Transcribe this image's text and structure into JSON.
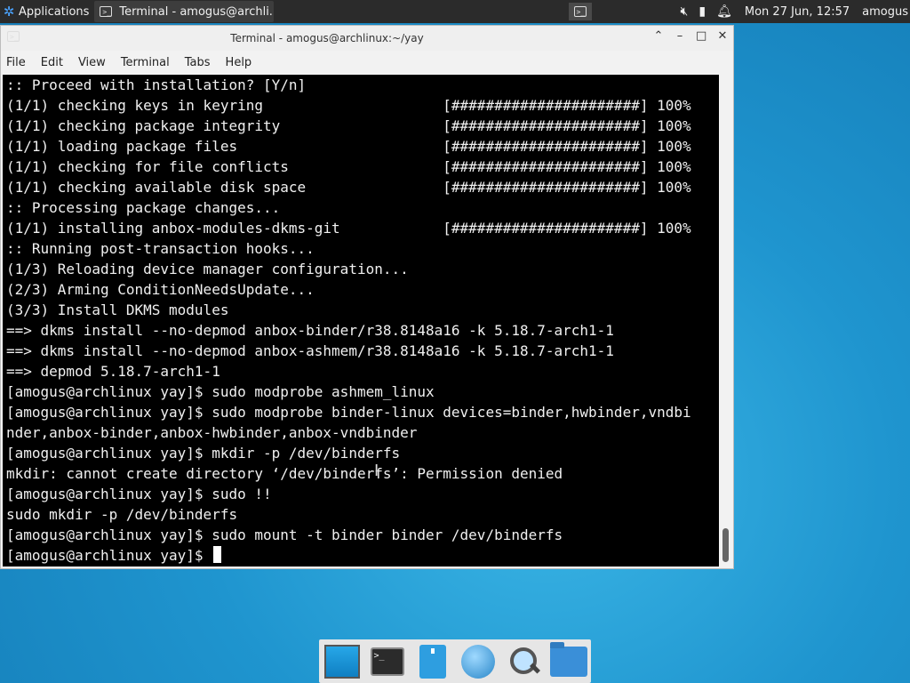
{
  "panel": {
    "applications_label": "Applications",
    "task_label": "Terminal - amogus@archli...",
    "clock": "Mon 27 Jun, 12:57",
    "user": "amogus"
  },
  "window": {
    "title": "Terminal - amogus@archlinux:~/yay",
    "menu": [
      "File",
      "Edit",
      "View",
      "Terminal",
      "Tabs",
      "Help"
    ]
  },
  "terminal": {
    "lines": [
      ":: Proceed with installation? [Y/n]",
      "(1/1) checking keys in keyring                     [######################] 100%",
      "(1/1) checking package integrity                   [######################] 100%",
      "(1/1) loading package files                        [######################] 100%",
      "(1/1) checking for file conflicts                  [######################] 100%",
      "(1/1) checking available disk space                [######################] 100%",
      ":: Processing package changes...",
      "(1/1) installing anbox-modules-dkms-git            [######################] 100%",
      ":: Running post-transaction hooks...",
      "(1/3) Reloading device manager configuration...",
      "(2/3) Arming ConditionNeedsUpdate...",
      "(3/3) Install DKMS modules",
      "==> dkms install --no-depmod anbox-binder/r38.8148a16 -k 5.18.7-arch1-1",
      "==> dkms install --no-depmod anbox-ashmem/r38.8148a16 -k 5.18.7-arch1-1",
      "==> depmod 5.18.7-arch1-1",
      "[amogus@archlinux yay]$ sudo modprobe ashmem_linux",
      "[amogus@archlinux yay]$ sudo modprobe binder-linux devices=binder,hwbinder,vndbi",
      "nder,anbox-binder,anbox-hwbinder,anbox-vndbinder",
      "[amogus@archlinux yay]$ mkdir -p /dev/binderfs",
      "mkdir: cannot create directory ‘/dev/binderfs’: Permission denied",
      "[amogus@archlinux yay]$ sudo !!",
      "sudo mkdir -p /dev/binderfs",
      "[amogus@archlinux yay]$ sudo mount -t binder binder /dev/binderfs"
    ],
    "prompt": "[amogus@archlinux yay]$ "
  },
  "icons": {
    "apps": "xfce-menu-icon",
    "terminal": "terminal-icon",
    "mute": "volume-muted-icon",
    "battery": "battery-icon",
    "bell": "notification-bell-icon"
  },
  "colors": {
    "panel": "#2b2b2b",
    "terminal_bg": "#000000",
    "terminal_fg": "#f0f0f0",
    "desktop": "#1f95cf"
  }
}
